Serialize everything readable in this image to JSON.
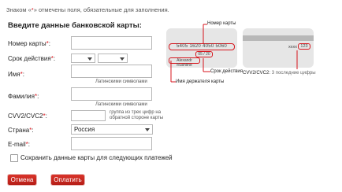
{
  "notice": {
    "before": "Знаком «",
    "star": "*",
    "after": "» отмечены поля, обязательные для заполнения."
  },
  "form": {
    "title": "Введите данные банковской карты:",
    "card_number": {
      "label": "Номер карты",
      "req": "*",
      "colon": ":",
      "value": ""
    },
    "expiry": {
      "label": "Срок действия",
      "req": "*",
      "colon": ":",
      "month": "",
      "year": ""
    },
    "name": {
      "label": "Имя",
      "req": "*",
      "colon": ":",
      "value": "",
      "hint": "Латинскими символами"
    },
    "surname": {
      "label": "Фамилия",
      "req": "*",
      "colon": ":",
      "value": "",
      "hint": "Латинскими символами"
    },
    "cvv": {
      "label": "CVV2/CVC2",
      "req": "*",
      "colon": ":",
      "value": "",
      "hint_line1": "группа из трех цифр на",
      "hint_line2": "обратной стороне карты"
    },
    "country": {
      "label": "Страна",
      "req": "*",
      "colon": ":",
      "value": "Россия"
    },
    "email": {
      "label": "E-mail",
      "req": "*",
      "colon": ":",
      "value": ""
    },
    "save_card": {
      "label": "Сохранить данные карты для следующих платежей",
      "checked": false
    }
  },
  "buttons": {
    "cancel": "Отмена",
    "pay": "Оплатить"
  },
  "card_illustration": {
    "number_label": "Номер карты",
    "number": "5405 1620 4050 5060",
    "expiry": "05 / 20",
    "holder": "Alexandr Rushline",
    "expiry_label": "Срок действия",
    "holder_label": "Имя держателя карты",
    "back_digits": "xxxx",
    "back_cvv": "123",
    "cvv_label": "CVV2/CVC2",
    "cvv_hint": "3 последние цифры"
  },
  "colors": {
    "accent": "#d7141c",
    "button": "#c4231b"
  }
}
